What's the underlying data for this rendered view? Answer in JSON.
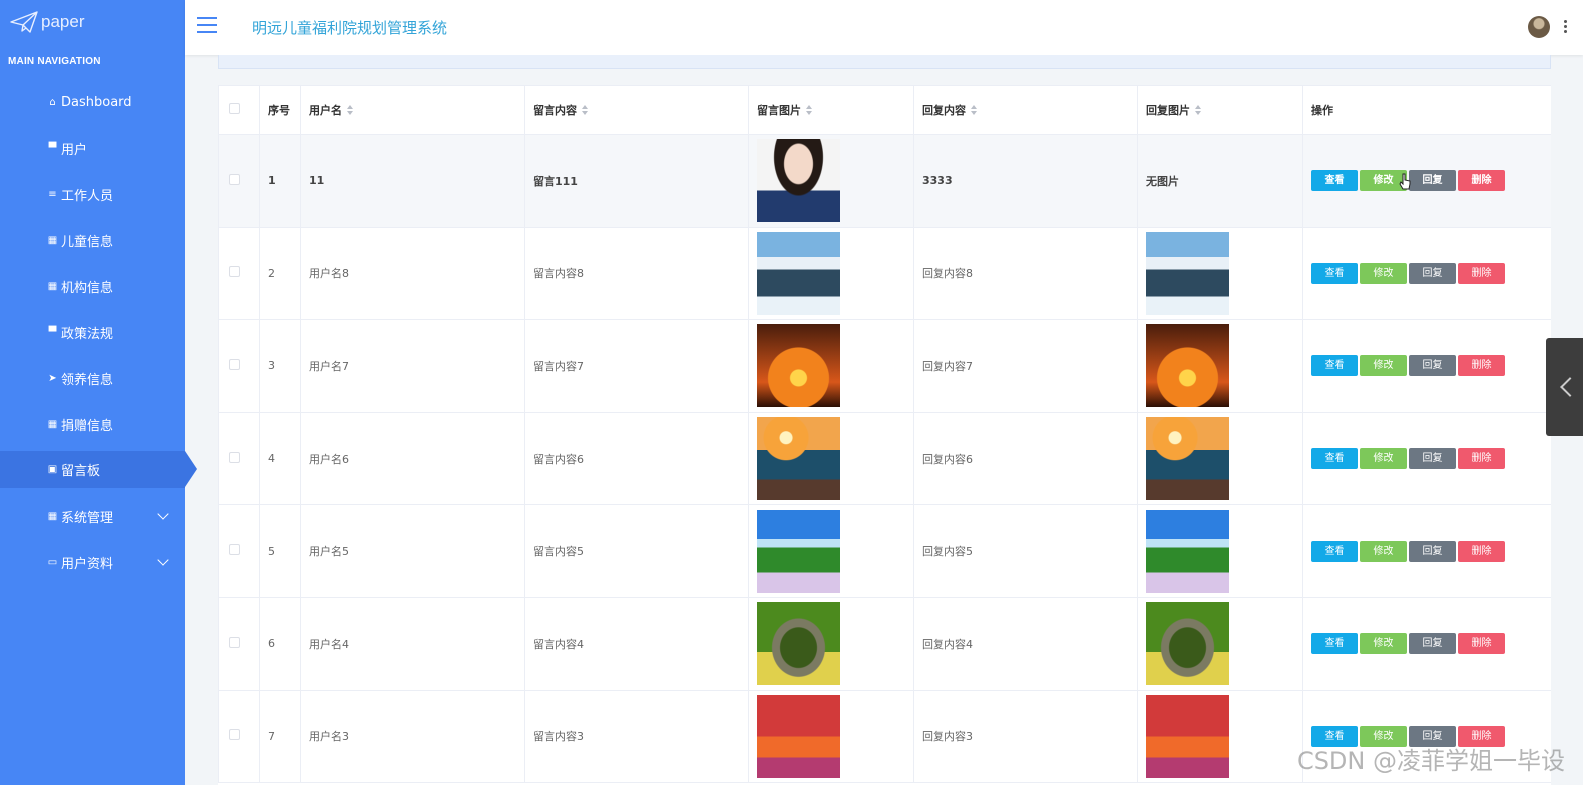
{
  "brand": {
    "name": "paper"
  },
  "sidebar": {
    "section_title": "MAIN NAVIGATION",
    "items": [
      {
        "label": "Dashboard",
        "icon": "home-icon",
        "glyph": "⌂"
      },
      {
        "label": "用户",
        "icon": "comment-icon",
        "glyph": "▀"
      },
      {
        "label": "工作人员",
        "icon": "list-icon",
        "glyph": "≡"
      },
      {
        "label": "儿童信息",
        "icon": "grid-icon",
        "glyph": "▦"
      },
      {
        "label": "机构信息",
        "icon": "grid-icon",
        "glyph": "▦"
      },
      {
        "label": "政策法规",
        "icon": "comment-icon",
        "glyph": "▀"
      },
      {
        "label": "领养信息",
        "icon": "send-icon",
        "glyph": "➤"
      },
      {
        "label": "捐赠信息",
        "icon": "grid-icon",
        "glyph": "▦"
      },
      {
        "label": "留言板",
        "icon": "clipboard-icon",
        "glyph": "▣"
      },
      {
        "label": "系统管理",
        "icon": "grid-icon",
        "glyph": "▦"
      },
      {
        "label": "用户资料",
        "icon": "card-icon",
        "glyph": "▭"
      }
    ],
    "active_index": 8
  },
  "header": {
    "title": "明远儿童福利院规划管理系统"
  },
  "table": {
    "columns": [
      "序号",
      "用户名",
      "留言内容",
      "留言图片",
      "回复内容",
      "回复图片",
      "操作"
    ],
    "actions": {
      "view": "查看",
      "edit": "修改",
      "reply": "回复",
      "delete": "删除"
    },
    "rows": [
      {
        "index": "1",
        "username": "11",
        "content": "留言111",
        "image": "img-girl",
        "reply": "3333",
        "reply_image_text": "无图片"
      },
      {
        "index": "2",
        "username": "用户名8",
        "content": "留言内容8",
        "image": "img-snow",
        "reply": "回复内容8",
        "reply_image": "img-snow"
      },
      {
        "index": "3",
        "username": "用户名7",
        "content": "留言内容7",
        "image": "img-palm",
        "reply": "回复内容7",
        "reply_image": "img-palm"
      },
      {
        "index": "4",
        "username": "用户名6",
        "content": "留言内容6",
        "image": "img-sea",
        "reply": "回复内容6",
        "reply_image": "img-sea"
      },
      {
        "index": "5",
        "username": "用户名5",
        "content": "留言内容5",
        "image": "img-meadow",
        "reply": "回复内容5",
        "reply_image": "img-meadow"
      },
      {
        "index": "6",
        "username": "用户名4",
        "content": "留言内容4",
        "image": "img-bridge",
        "reply": "回复内容4",
        "reply_image": "img-bridge"
      },
      {
        "index": "7",
        "username": "用户名3",
        "content": "留言内容3",
        "image": "img-autumn",
        "reply": "回复内容3",
        "reply_image": "img-autumn"
      }
    ]
  },
  "watermark": "CSDN @凌菲学姐一毕设",
  "colors": {
    "sidebar": "#4786f5",
    "sidebar_active": "#3b74e2",
    "title": "#33a4d8",
    "view": "#13a9e8",
    "edit": "#7dc85a",
    "reply": "#6c7783",
    "delete": "#f0596d"
  }
}
